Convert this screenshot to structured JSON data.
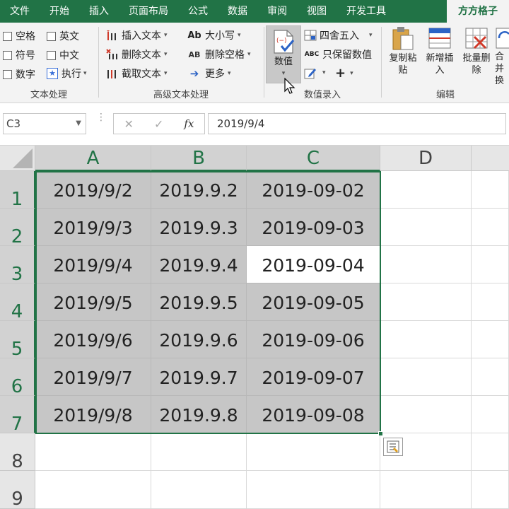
{
  "menu": {
    "tabs": [
      "文件",
      "开始",
      "插入",
      "页面布局",
      "公式",
      "数据",
      "审阅",
      "视图",
      "开发工具"
    ],
    "active_tab": "方方格子"
  },
  "ribbon": {
    "text_group": {
      "label": "文本处理",
      "checks": [
        "空格",
        "英文",
        "符号",
        "中文",
        "数字"
      ],
      "execute": "执行"
    },
    "advanced_group": {
      "label": "高级文本处理",
      "insert_text": "插入文本",
      "delete_text": "删除文本",
      "cut_text": "截取文本",
      "case_icon": "Ab",
      "case": "大小写",
      "delete_space_icon": "AB",
      "delete_space": "删除空格",
      "more": "更多"
    },
    "entry_group": {
      "label": "数值录入",
      "value_button": "数值",
      "round": "四舍五入",
      "keep_value_icon": "ABC",
      "keep_value": "只保留数值"
    },
    "edit_group": {
      "label": "编辑",
      "copy_paste_1": "复制粘",
      "copy_paste_2": "贴",
      "new_insert_1": "新增插",
      "new_insert_2": "入",
      "batch_delete_1": "批量删",
      "batch_delete_2": "除",
      "merge_1": "合并",
      "merge_2": "换"
    }
  },
  "formula_bar": {
    "name_box": "C3",
    "formula": "2019/9/4"
  },
  "sheet": {
    "columns": [
      "A",
      "B",
      "C",
      "D"
    ],
    "rows": [
      "1",
      "2",
      "3",
      "4",
      "5",
      "6",
      "7",
      "8",
      "9"
    ],
    "data": [
      [
        "2019/9/2",
        "2019.9.2",
        "2019-09-02"
      ],
      [
        "2019/9/3",
        "2019.9.3",
        "2019-09-03"
      ],
      [
        "2019/9/4",
        "2019.9.4",
        "2019-09-04"
      ],
      [
        "2019/9/5",
        "2019.9.5",
        "2019-09-05"
      ],
      [
        "2019/9/6",
        "2019.9.6",
        "2019-09-06"
      ],
      [
        "2019/9/7",
        "2019.9.7",
        "2019-09-07"
      ],
      [
        "2019/9/8",
        "2019.9.8",
        "2019-09-08"
      ]
    ],
    "active_cell": "C3",
    "selection": "A1:C7"
  },
  "colors": {
    "accent": "#217346",
    "selection_fill": "#c6c6c6"
  }
}
